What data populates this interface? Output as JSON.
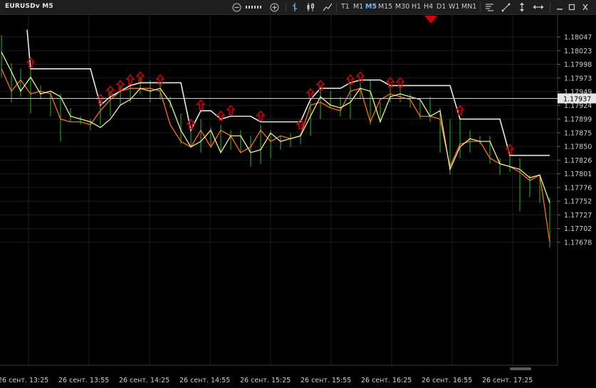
{
  "window": {
    "title": "EURUSDv M5"
  },
  "toolbar": {
    "zoom_out_icon": "minus-circle-icon",
    "zoom_in_icon": "plus-circle-icon",
    "timeframes": [
      "T1",
      "M1",
      "M5",
      "M15",
      "M30",
      "H1",
      "H4",
      "D1",
      "W1",
      "MN1"
    ],
    "active_timeframe": "M5",
    "tools": [
      "bar-chart-icon",
      "candlestick-icon",
      "line-chart-icon",
      "indicator-icon",
      "trendline-icon",
      "vertical-line-icon",
      "horizontal-line-icon"
    ],
    "window_controls": [
      "minimize-icon",
      "restore-icon",
      "close-icon"
    ]
  },
  "chart_data": {
    "type": "line",
    "symbol": "EURUSDv",
    "timeframe": "M5",
    "ylim": [
      1.1766,
      1.1806
    ],
    "y_ticks": [
      "1.18047",
      "1.18023",
      "1.17998",
      "1.17973",
      "1.17949",
      "1.17924",
      "1.17899",
      "1.17875",
      "1.17850",
      "1.17826",
      "1.17801",
      "1.17776",
      "1.17752",
      "1.17727",
      "1.17702",
      "1.17678"
    ],
    "x_tick_labels": [
      "26 сент. 13:25",
      "26 сент. 13:55",
      "26 сент. 14:25",
      "26 сент. 14:55",
      "26 сент. 15:25",
      "26 сент. 15:55",
      "26 сент. 16:25",
      "26 сент. 16:55",
      "26 сент. 17:25"
    ],
    "current_price": "1.17937",
    "colors": {
      "background": "#000000",
      "grid": "#1c1c1c",
      "bars": "#1e8c1e",
      "series_orange": "#ff6a1a",
      "series_yellow": "#f0f090",
      "step_line": "#e8e8e8",
      "signal_arrow": "#cc0000",
      "price_line": "#cfcfcf"
    },
    "bars": [
      {
        "x": 0,
        "h": 1.1805,
        "l": 1.17975
      },
      {
        "x": 14,
        "h": 1.18,
        "l": 1.1793
      },
      {
        "x": 27,
        "h": 1.1799,
        "l": 1.1794
      },
      {
        "x": 41,
        "h": 1.1799,
        "l": 1.1791
      },
      {
        "x": 55,
        "h": 1.1796,
        "l": 1.17935
      },
      {
        "x": 69,
        "h": 1.1795,
        "l": 1.17905
      },
      {
        "x": 83,
        "h": 1.17945,
        "l": 1.1786
      },
      {
        "x": 97,
        "h": 1.1792,
        "l": 1.17895
      },
      {
        "x": 111,
        "h": 1.17905,
        "l": 1.1789
      },
      {
        "x": 125,
        "h": 1.179,
        "l": 1.1788
      },
      {
        "x": 139,
        "h": 1.17935,
        "l": 1.1789
      },
      {
        "x": 153,
        "h": 1.1795,
        "l": 1.17905
      },
      {
        "x": 167,
        "h": 1.1796,
        "l": 1.17925
      },
      {
        "x": 181,
        "h": 1.17965,
        "l": 1.1793
      },
      {
        "x": 195,
        "h": 1.17975,
        "l": 1.17945
      },
      {
        "x": 209,
        "h": 1.1797,
        "l": 1.1793
      },
      {
        "x": 223,
        "h": 1.17965,
        "l": 1.17935
      },
      {
        "x": 237,
        "h": 1.1794,
        "l": 1.1792
      },
      {
        "x": 252,
        "h": 1.1791,
        "l": 1.17855
      },
      {
        "x": 266,
        "h": 1.1788,
        "l": 1.1785
      },
      {
        "x": 280,
        "h": 1.179,
        "l": 1.1784
      },
      {
        "x": 294,
        "h": 1.17885,
        "l": 1.1785
      },
      {
        "x": 308,
        "h": 1.1789,
        "l": 1.1784
      },
      {
        "x": 322,
        "h": 1.1788,
        "l": 1.17845
      },
      {
        "x": 336,
        "h": 1.1788,
        "l": 1.1784
      },
      {
        "x": 350,
        "h": 1.1787,
        "l": 1.17815
      },
      {
        "x": 364,
        "h": 1.1789,
        "l": 1.1782
      },
      {
        "x": 378,
        "h": 1.1788,
        "l": 1.1783
      },
      {
        "x": 392,
        "h": 1.1787,
        "l": 1.17845
      },
      {
        "x": 406,
        "h": 1.17875,
        "l": 1.1785
      },
      {
        "x": 420,
        "h": 1.17875,
        "l": 1.17855
      },
      {
        "x": 434,
        "h": 1.1793,
        "l": 1.1787
      },
      {
        "x": 448,
        "h": 1.1796,
        "l": 1.179
      },
      {
        "x": 462,
        "h": 1.1795,
        "l": 1.1792
      },
      {
        "x": 476,
        "h": 1.1794,
        "l": 1.17905
      },
      {
        "x": 490,
        "h": 1.1796,
        "l": 1.179
      },
      {
        "x": 504,
        "h": 1.17965,
        "l": 1.17935
      },
      {
        "x": 518,
        "h": 1.1797,
        "l": 1.1789
      },
      {
        "x": 532,
        "h": 1.1793,
        "l": 1.17895
      },
      {
        "x": 546,
        "h": 1.17955,
        "l": 1.1793
      },
      {
        "x": 560,
        "h": 1.1796,
        "l": 1.1793
      },
      {
        "x": 574,
        "h": 1.17945,
        "l": 1.1792
      },
      {
        "x": 588,
        "h": 1.17935,
        "l": 1.179
      },
      {
        "x": 602,
        "h": 1.1794,
        "l": 1.17895
      },
      {
        "x": 616,
        "h": 1.1792,
        "l": 1.1784
      },
      {
        "x": 630,
        "h": 1.179,
        "l": 1.178
      },
      {
        "x": 644,
        "h": 1.179,
        "l": 1.1783
      },
      {
        "x": 658,
        "h": 1.1788,
        "l": 1.1784
      },
      {
        "x": 672,
        "h": 1.1787,
        "l": 1.17855
      },
      {
        "x": 686,
        "h": 1.1787,
        "l": 1.1782
      },
      {
        "x": 700,
        "h": 1.1783,
        "l": 1.178
      },
      {
        "x": 714,
        "h": 1.17835,
        "l": 1.17805
      },
      {
        "x": 728,
        "h": 1.1783,
        "l": 1.17735
      },
      {
        "x": 742,
        "h": 1.178,
        "l": 1.1776
      },
      {
        "x": 756,
        "h": 1.178,
        "l": 1.1775
      },
      {
        "x": 770,
        "h": 1.1776,
        "l": 1.1767
      }
    ],
    "orange_line": [
      [
        0,
        1.1799
      ],
      [
        14,
        1.1795
      ],
      [
        27,
        1.1797
      ],
      [
        41,
        1.17945
      ],
      [
        55,
        1.1795
      ],
      [
        69,
        1.17945
      ],
      [
        83,
        1.179
      ],
      [
        97,
        1.17895
      ],
      [
        111,
        1.17895
      ],
      [
        125,
        1.1789
      ],
      [
        139,
        1.17915
      ],
      [
        153,
        1.17935
      ],
      [
        167,
        1.1795
      ],
      [
        181,
        1.17955
      ],
      [
        195,
        1.17955
      ],
      [
        209,
        1.17955
      ],
      [
        223,
        1.1795
      ],
      [
        237,
        1.1789
      ],
      [
        252,
        1.1786
      ],
      [
        266,
        1.1785
      ],
      [
        280,
        1.1788
      ],
      [
        294,
        1.1785
      ],
      [
        308,
        1.1788
      ],
      [
        322,
        1.1787
      ],
      [
        336,
        1.1784
      ],
      [
        350,
        1.1785
      ],
      [
        364,
        1.1788
      ],
      [
        378,
        1.1786
      ],
      [
        392,
        1.1787
      ],
      [
        406,
        1.17865
      ],
      [
        420,
        1.1787
      ],
      [
        434,
        1.17925
      ],
      [
        448,
        1.1793
      ],
      [
        462,
        1.1792
      ],
      [
        476,
        1.17915
      ],
      [
        490,
        1.1795
      ],
      [
        504,
        1.17955
      ],
      [
        518,
        1.17895
      ],
      [
        532,
        1.17935
      ],
      [
        546,
        1.17945
      ],
      [
        560,
        1.1794
      ],
      [
        574,
        1.17935
      ],
      [
        588,
        1.17905
      ],
      [
        602,
        1.17905
      ],
      [
        616,
        1.179
      ],
      [
        630,
        1.17815
      ],
      [
        644,
        1.17855
      ],
      [
        658,
        1.1786
      ],
      [
        672,
        1.1786
      ],
      [
        686,
        1.1783
      ],
      [
        700,
        1.1782
      ],
      [
        714,
        1.17815
      ],
      [
        728,
        1.17805
      ],
      [
        742,
        1.1779
      ],
      [
        756,
        1.178
      ],
      [
        770,
        1.1768
      ]
    ],
    "yellow_line": [
      [
        0,
        1.1802
      ],
      [
        14,
        1.17985
      ],
      [
        27,
        1.1795
      ],
      [
        41,
        1.17975
      ],
      [
        55,
        1.17945
      ],
      [
        69,
        1.1795
      ],
      [
        83,
        1.1794
      ],
      [
        97,
        1.17905
      ],
      [
        111,
        1.179
      ],
      [
        125,
        1.17895
      ],
      [
        139,
        1.17885
      ],
      [
        153,
        1.179
      ],
      [
        167,
        1.17925
      ],
      [
        181,
        1.17935
      ],
      [
        195,
        1.17955
      ],
      [
        209,
        1.1795
      ],
      [
        223,
        1.17955
      ],
      [
        237,
        1.1793
      ],
      [
        252,
        1.1788
      ],
      [
        266,
        1.1785
      ],
      [
        280,
        1.1786
      ],
      [
        294,
        1.1788
      ],
      [
        308,
        1.1784
      ],
      [
        322,
        1.1787
      ],
      [
        336,
        1.1787
      ],
      [
        350,
        1.1784
      ],
      [
        364,
        1.17845
      ],
      [
        378,
        1.17875
      ],
      [
        392,
        1.1786
      ],
      [
        406,
        1.17865
      ],
      [
        420,
        1.1787
      ],
      [
        434,
        1.17905
      ],
      [
        448,
        1.1794
      ],
      [
        462,
        1.17925
      ],
      [
        476,
        1.1792
      ],
      [
        490,
        1.1793
      ],
      [
        504,
        1.17955
      ],
      [
        518,
        1.1795
      ],
      [
        532,
        1.17895
      ],
      [
        546,
        1.1794
      ],
      [
        560,
        1.17945
      ],
      [
        574,
        1.1794
      ],
      [
        588,
        1.17935
      ],
      [
        602,
        1.17905
      ],
      [
        616,
        1.17915
      ],
      [
        630,
        1.1781
      ],
      [
        644,
        1.1785
      ],
      [
        658,
        1.17865
      ],
      [
        672,
        1.1786
      ],
      [
        686,
        1.1786
      ],
      [
        700,
        1.1782
      ],
      [
        714,
        1.17815
      ],
      [
        728,
        1.1781
      ],
      [
        742,
        1.17795
      ],
      [
        756,
        1.178
      ],
      [
        770,
        1.1775
      ]
    ],
    "step_line": [
      [
        36,
        1.1806
      ],
      [
        41,
        1.1799
      ],
      [
        125,
        1.1799
      ],
      [
        139,
        1.17925
      ],
      [
        153,
        1.1794
      ],
      [
        181,
        1.1796
      ],
      [
        195,
        1.17965
      ],
      [
        223,
        1.17965
      ],
      [
        252,
        1.17965
      ],
      [
        266,
        1.1788
      ],
      [
        280,
        1.17915
      ],
      [
        294,
        1.17915
      ],
      [
        308,
        1.179
      ],
      [
        322,
        1.17905
      ],
      [
        350,
        1.17905
      ],
      [
        364,
        1.17895
      ],
      [
        420,
        1.17895
      ],
      [
        434,
        1.17935
      ],
      [
        448,
        1.17955
      ],
      [
        476,
        1.17955
      ],
      [
        490,
        1.17965
      ],
      [
        504,
        1.1797
      ],
      [
        532,
        1.1797
      ],
      [
        546,
        1.1796
      ],
      [
        630,
        1.1796
      ],
      [
        644,
        1.179
      ],
      [
        700,
        1.179
      ],
      [
        714,
        1.17835
      ],
      [
        770,
        1.17835
      ]
    ],
    "signal_arrows": [
      [
        41,
        1.1799
      ],
      [
        139,
        1.17925
      ],
      [
        153,
        1.1794
      ],
      [
        167,
        1.1795
      ],
      [
        181,
        1.1796
      ],
      [
        195,
        1.17965
      ],
      [
        223,
        1.1796
      ],
      [
        266,
        1.1788
      ],
      [
        280,
        1.17915
      ],
      [
        308,
        1.17895
      ],
      [
        322,
        1.17905
      ],
      [
        364,
        1.17895
      ],
      [
        420,
        1.1788
      ],
      [
        434,
        1.17935
      ],
      [
        448,
        1.1795
      ],
      [
        490,
        1.1796
      ],
      [
        504,
        1.17965
      ],
      [
        546,
        1.17955
      ],
      [
        560,
        1.17955
      ],
      [
        644,
        1.17905
      ],
      [
        714,
        1.17835
      ]
    ],
    "grid": true,
    "legend": "none"
  }
}
